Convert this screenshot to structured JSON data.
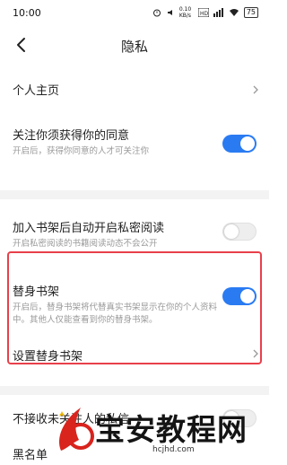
{
  "status_bar": {
    "time": "10:00",
    "speed": "0.10 KB/s",
    "battery": "75"
  },
  "nav": {
    "title": "隐私"
  },
  "rows": {
    "homepage": {
      "title": "个人主页"
    },
    "follow_consent": {
      "title": "关注你须获得你的同意",
      "sub": "开启后，获得你同意的人才可关注你",
      "on": true
    },
    "private_read": {
      "title": "加入书架后自动开启私密阅读",
      "sub": "开启私密阅读的书籍阅读动态不会公开",
      "on": false
    },
    "proxy_shelf": {
      "title": "替身书架",
      "sub": "开启后，替身书架将代替真实书架显示在你的个人资料中。其他人仅能查看到你的替身书架。",
      "on": true
    },
    "set_proxy": {
      "title": "设置替身书架"
    },
    "no_dm": {
      "title": "不接收未关注人的私信",
      "on": false
    },
    "blacklist": {
      "title": "黑名单"
    }
  },
  "watermark": {
    "text": "宝安教程网",
    "url": "hcjhd.com"
  },
  "colors": {
    "accent": "#2a7bf2",
    "highlight": "#e8404a",
    "watermark_red": "#d9231d"
  }
}
